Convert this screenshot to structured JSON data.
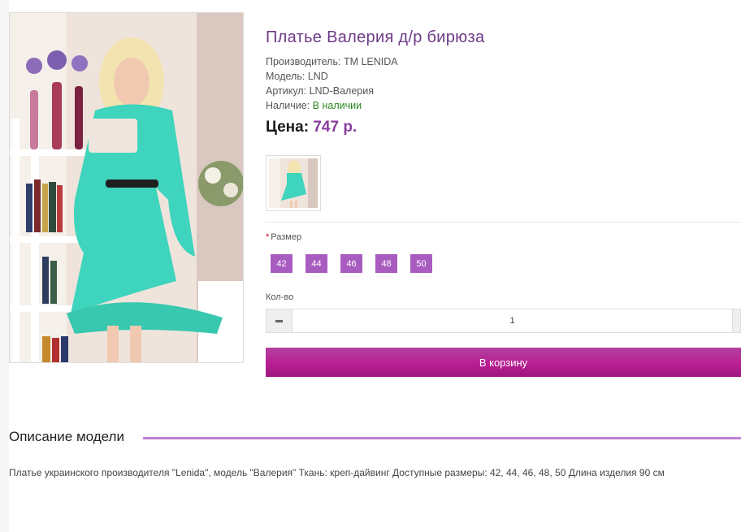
{
  "product": {
    "title": "Платье Валерия д/р бирюза",
    "manufacturer_label": "Производитель:",
    "manufacturer": "TM LENIDA",
    "model_label": "Модель:",
    "model": "LND",
    "sku_label": "Артикул:",
    "sku": "LND-Валерия",
    "availability_label": "Наличие:",
    "availability": "В наличии",
    "price_label": "Цена:",
    "price": "747 р."
  },
  "options": {
    "size_label": "Размер",
    "required_mark": "*",
    "sizes": [
      "42",
      "44",
      "46",
      "48",
      "50"
    ]
  },
  "quantity": {
    "label": "Кол-во",
    "value": "1"
  },
  "cart": {
    "button_label": "В корзину"
  },
  "description": {
    "heading": "Описание модели",
    "text": "Платье украинского производителя \"Lenida\", модель \"Валерия\" Ткань: креп-дайвинг Доступные размеры: 42, 44, 46, 48, 50 Длина изделия 90 см"
  },
  "colors": {
    "title": "#6d3a86",
    "price": "#8a3d9c",
    "in_stock": "#2b8a1f",
    "size_button": "#a85cc0",
    "cart_button": "#b81f94",
    "description_rule": "#c07fd0"
  }
}
